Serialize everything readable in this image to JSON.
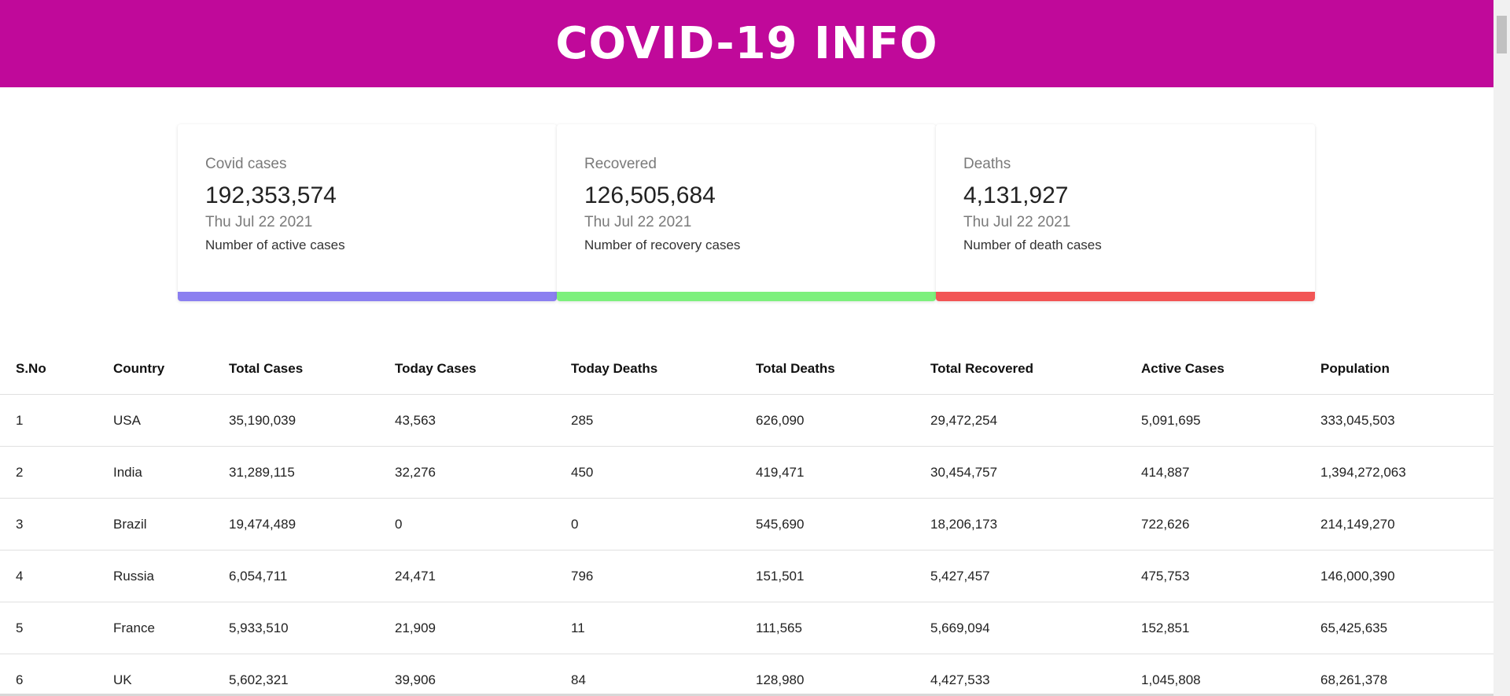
{
  "header": {
    "title": "COVID-19 INFO"
  },
  "colors": {
    "header_bg": "#c0099a",
    "cases_bar": "#8b7ff0",
    "recovered_bar": "#7df07d",
    "deaths_bar": "#f25555"
  },
  "cards": [
    {
      "title": "Covid cases",
      "value": "192,353,574",
      "date": "Thu Jul 22 2021",
      "desc": "Number of active cases"
    },
    {
      "title": "Recovered",
      "value": "126,505,684",
      "date": "Thu Jul 22 2021",
      "desc": "Number of recovery cases"
    },
    {
      "title": "Deaths",
      "value": "4,131,927",
      "date": "Thu Jul 22 2021",
      "desc": "Number of death cases"
    }
  ],
  "table": {
    "headers": [
      "S.No",
      "Country",
      "Total Cases",
      "Today Cases",
      "Today Deaths",
      "Total Deaths",
      "Total Recovered",
      "Active Cases",
      "Population"
    ],
    "rows": [
      [
        "1",
        "USA",
        "35,190,039",
        "43,563",
        "285",
        "626,090",
        "29,472,254",
        "5,091,695",
        "333,045,503"
      ],
      [
        "2",
        "India",
        "31,289,115",
        "32,276",
        "450",
        "419,471",
        "30,454,757",
        "414,887",
        "1,394,272,063"
      ],
      [
        "3",
        "Brazil",
        "19,474,489",
        "0",
        "0",
        "545,690",
        "18,206,173",
        "722,626",
        "214,149,270"
      ],
      [
        "4",
        "Russia",
        "6,054,711",
        "24,471",
        "796",
        "151,501",
        "5,427,457",
        "475,753",
        "146,000,390"
      ],
      [
        "5",
        "France",
        "5,933,510",
        "21,909",
        "11",
        "111,565",
        "5,669,094",
        "152,851",
        "65,425,635"
      ],
      [
        "6",
        "UK",
        "5,602,321",
        "39,906",
        "84",
        "128,980",
        "4,427,533",
        "1,045,808",
        "68,261,378"
      ]
    ]
  }
}
